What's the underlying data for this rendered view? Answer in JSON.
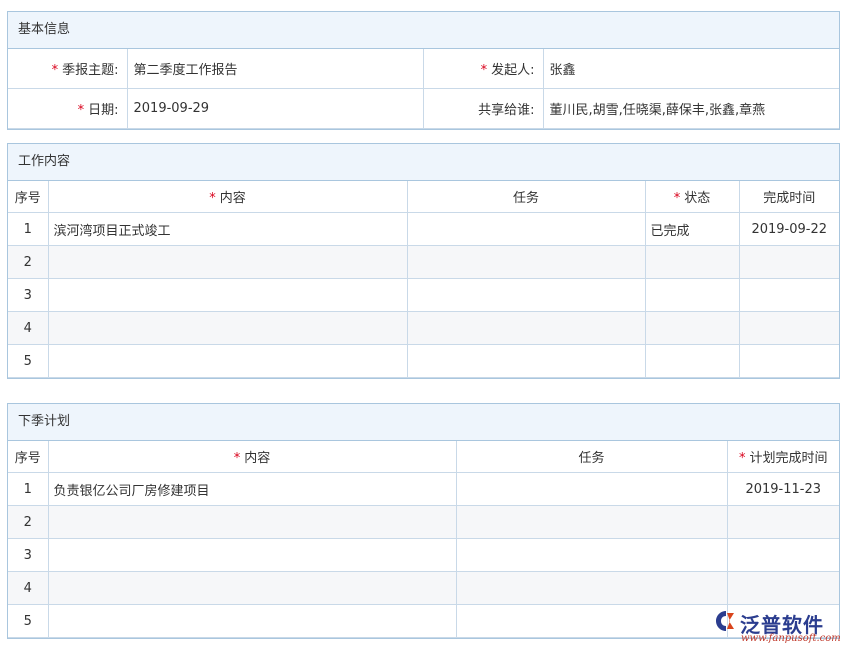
{
  "basic": {
    "title": "基本信息",
    "subject_label": "季报主题:",
    "subject_value": "第二季度工作报告",
    "initiator_label": "发起人:",
    "initiator_value": "张鑫",
    "date_label": "日期:",
    "date_value": "2019-09-29",
    "share_label": "共享给谁:",
    "share_value": "董川民,胡雪,任晓渠,薛保丰,张鑫,章燕"
  },
  "work": {
    "title": "工作内容",
    "headers": {
      "index": "序号",
      "content": "内容",
      "task": "任务",
      "status": "状态",
      "done_time": "完成时间"
    },
    "rows": [
      {
        "index": "1",
        "content": "滨河湾项目正式竣工",
        "task": "",
        "status": "已完成",
        "done_time": "2019-09-22"
      },
      {
        "index": "2",
        "content": "",
        "task": "",
        "status": "",
        "done_time": ""
      },
      {
        "index": "3",
        "content": "",
        "task": "",
        "status": "",
        "done_time": ""
      },
      {
        "index": "4",
        "content": "",
        "task": "",
        "status": "",
        "done_time": ""
      },
      {
        "index": "5",
        "content": "",
        "task": "",
        "status": "",
        "done_time": ""
      }
    ]
  },
  "plan": {
    "title": "下季计划",
    "headers": {
      "index": "序号",
      "content": "内容",
      "task": "任务",
      "plan_time": "计划完成时间"
    },
    "rows": [
      {
        "index": "1",
        "content": "负责银亿公司厂房修建项目",
        "task": "",
        "plan_time": "2019-11-23"
      },
      {
        "index": "2",
        "content": "",
        "task": "",
        "plan_time": ""
      },
      {
        "index": "3",
        "content": "",
        "task": "",
        "plan_time": ""
      },
      {
        "index": "4",
        "content": "",
        "task": "",
        "plan_time": ""
      },
      {
        "index": "5",
        "content": "",
        "task": "",
        "plan_time": ""
      }
    ]
  },
  "required_mark": "*",
  "logo": {
    "brand": "泛普软件",
    "url": "www.fanpusoft.com"
  },
  "colors": {
    "header_bg": "#eef5fc",
    "border": "#a9c6de",
    "required": "#d9001b"
  }
}
